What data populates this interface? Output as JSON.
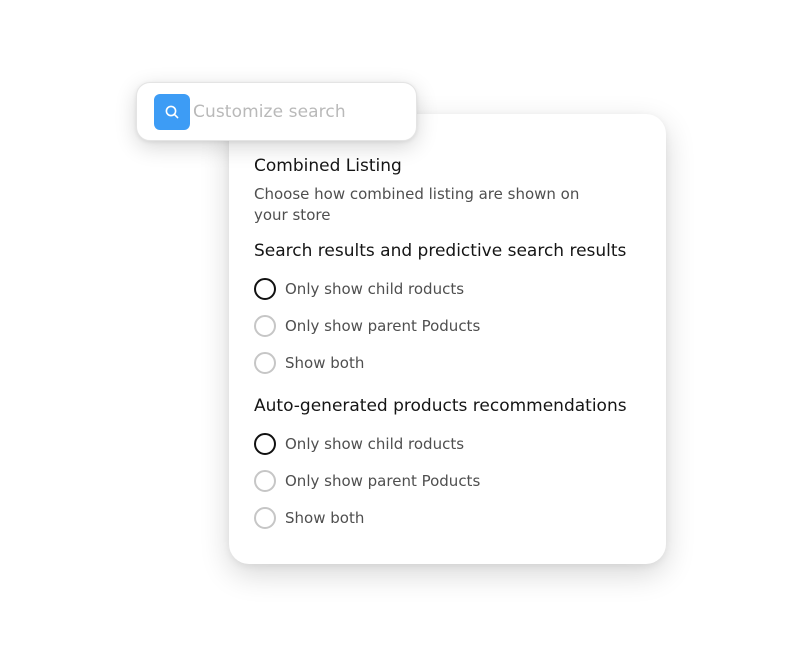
{
  "search": {
    "placeholder": "Customize search",
    "icon": "search-icon",
    "icon_bg_color": "#3d9cf5"
  },
  "panel": {
    "title": "Combined Listing",
    "description": "Choose how combined listing are shown on your store",
    "sections": [
      {
        "heading": "Search results and predictive search results",
        "options": [
          {
            "label": "Only show child roducts",
            "selected": true
          },
          {
            "label": "Only show parent Poducts",
            "selected": false
          },
          {
            "label": "Show both",
            "selected": false
          }
        ]
      },
      {
        "heading": "Auto-generated products recommendations",
        "options": [
          {
            "label": "Only show child roducts",
            "selected": true
          },
          {
            "label": "Only show parent Poducts",
            "selected": false
          },
          {
            "label": "Show both",
            "selected": false
          }
        ]
      }
    ]
  }
}
